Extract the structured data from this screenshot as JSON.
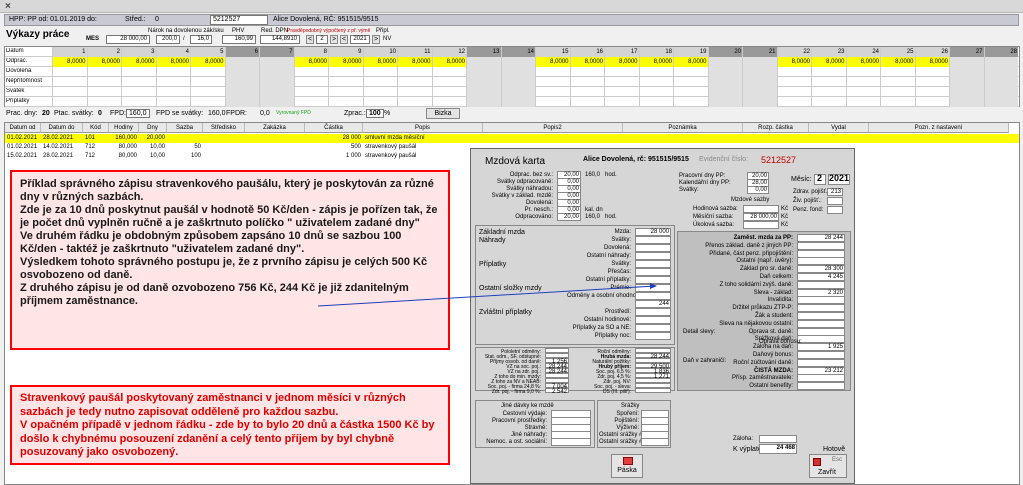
{
  "window": {
    "close_glyph": "×",
    "header_title": "HPP: PP od: 01.01.2019 do:",
    "header_stred_label": "Střed.:",
    "header_stred_value": "0",
    "header_code": "5212527",
    "header_employee": "Alice  Dovolená, RČ: 951515/9515"
  },
  "title": "Výkazy práce",
  "toolbar": {
    "narok_label": "Nárok na dovolenou zák/sku",
    "mes_label": "MES",
    "mes_value": "28 000,00",
    "v1": "200,0",
    "sep": "/",
    "v2": "16,0",
    "phv_label": "PHV",
    "phv_value": "160,99",
    "red_label": "Red. DPN",
    "red_value": "144,8910",
    "pravd_label": "Pravděpodobný výpočtený z př. výmě",
    "prip_label": "Připl.",
    "nav_prev": "<",
    "nav_month": "2",
    "nav_next": ">",
    "nav_prev2": "<",
    "nav_year": "2021",
    "nav_next2": ">",
    "nv_label": "NV"
  },
  "grid": {
    "row_labels": [
      "Datum",
      "Odprac.",
      "Dovolená",
      "Nepřítomnost",
      "Svátek",
      "Příplatky"
    ],
    "days": [
      "1",
      "2",
      "3",
      "4",
      "5",
      "6",
      "7",
      "8",
      "9",
      "10",
      "11",
      "12",
      "13",
      "14",
      "15",
      "16",
      "17",
      "18",
      "19",
      "20",
      "21",
      "22",
      "23",
      "24",
      "25",
      "26",
      "27",
      "28"
    ],
    "odprac_value": "8,0000"
  },
  "summary": {
    "prac_dny_label": "Prac. dny:",
    "prac_dny_value": "20",
    "ptac_svatky_label": "Ptac. svátky:",
    "ptac_svatky_value": "0",
    "fpd_label": "FPD:",
    "fpd_value": "160,0",
    "fpd_sv_label": "FPD se svátky:",
    "fpd_sv_value": "160,0",
    "fpdr_label": "FPDR:",
    "fpdr_value": "0,0",
    "vyrovnany_label": "Vyrovnaný FPD",
    "zprac_label": "Zprac.:",
    "zprac_value": "100",
    "zprac_unit": "%",
    "bizka_button": "Bizka"
  },
  "list": {
    "columns": [
      "Datum od",
      "Datum do",
      "Kód",
      "Hodiny",
      "Dny",
      "Sazba",
      "Středisko",
      "Zakázka",
      "Částka",
      "Popis",
      "Popis2",
      "Poznámka",
      "Rozp. částka",
      "Vydal",
      "Pozn. z nastavení"
    ],
    "rows": [
      {
        "od": "01.02.2021",
        "do": "28.02.2021",
        "kod": "101",
        "hod": "160,000",
        "dny": "20,000",
        "sazba": "",
        "stred": "",
        "zak": "",
        "castka": "28 000",
        "popis": "smluvní mzda měsíční"
      },
      {
        "od": "01.02.2021",
        "do": "14.02.2021",
        "kod": "712",
        "hod": "80,000",
        "dny": "10,00",
        "sazba": "50",
        "stred": "",
        "zak": "",
        "castka": "500",
        "popis": "stravenkový paušál"
      },
      {
        "od": "15.02.2021",
        "do": "28.02.2021",
        "kod": "712",
        "hod": "80,000",
        "dny": "10,00",
        "sazba": "100",
        "stred": "",
        "zak": "",
        "castka": "1 000",
        "popis": "stravenkový paušál"
      }
    ]
  },
  "callout1": {
    "text": "Příklad správného zápisu stravenkového paušálu, který je poskytován za různé dny v různých sazbách.\nZde je za 10 dnů poskytnut paušál v hodnotě 50 Kč/den - zápis je pořízen tak, že je počet dnů vyplněn ručně a je zaškrtnuto políčko \" uživatelem zadané dny\"\nVe druhém řádku je obdobným způsobem zapsáno 10 dnů se sazbou 100 Kč/den - taktéž je zaškrtnuto \"uživatelem zadané dny\".\nVýsledkem tohoto správného postupu je, že z prvního zápisu je celých 500 Kč osvobozeno od daně.\nZ druhého zápisu je od daně ozvobozeno 756 Kč, 244 Kč je již zdanitelným příjmem zaměstnance."
  },
  "callout2": {
    "text": "Stravenkový paušál poskytovaný zaměstnanci v jednom měsíci v různých sazbách je tedy nutno zapisovat odděleně pro každou sazbu.\nV opačném případě v jednom řádku - zde by to bylo 20 dnů a částka 1500 Kč by došlo k chybnému posouzení zdanění a celý tento příjem by byl chybně posuzovaný jako osvobozený."
  },
  "mzdova": {
    "title": "Mzdová karta",
    "employee": "Alice  Dovolená, rč: 951515/9515",
    "evid_label": "Evidenční číslo:",
    "evid_value": "5212527",
    "mesic_label": "Měsíc:",
    "mesic_value": "2",
    "rok_value": "2021",
    "zdrav_label": "Zdrav. pojišť.:",
    "zdrav_value": "213",
    "ziv_label": "Živ. pojišť.:",
    "penz_label": "Penz. fond:",
    "hours_left": [
      {
        "l": "Odprac. bez sv.:",
        "a": "20,00",
        "b": "160,0",
        "u": "hod."
      },
      {
        "l": "Svátky odpracované:",
        "a": "0,00",
        "b": "",
        "u": ""
      },
      {
        "l": "Svátky náhradou:",
        "a": "0,00",
        "b": "",
        "u": ""
      },
      {
        "l": "Svátky v základ. mzdě:",
        "a": "0,00",
        "b": "",
        "u": ""
      },
      {
        "l": "Dovolená:",
        "a": "0,00",
        "b": "",
        "u": ""
      },
      {
        "l": "Pr. nesch.:",
        "a": "0,00",
        "b": "kal. dn",
        "u": ""
      },
      {
        "l": "Odpracováno:",
        "a": "20,00",
        "b": "160,0",
        "u": "hod."
      }
    ],
    "pracdny_label": "Pracovní dny PP:",
    "pracdny_value": "20,00",
    "kaldny_label": "Kalendářní dny PP:",
    "kaldny_value": "28,00",
    "svatky_label": "Svátky:",
    "svatky_value": "0,00",
    "mzdove_sazby": "Mzdové sazby",
    "hod_sazba_label": "Hodinová sazba:",
    "mes_sazba_label": "Měsíční sazba:",
    "mes_sazba_value": "28 000,00",
    "ukol_label": "Úkolová sazba:",
    "kc": "Kč",
    "left_items": [
      {
        "l": "Základní mzda",
        "r": "Mzda:",
        "v": "28 000"
      },
      {
        "l": "Náhrady",
        "r": "Svátky:",
        "v": ""
      },
      {
        "l": "",
        "r": "Dovolená:",
        "v": ""
      },
      {
        "l": "",
        "r": "Ostatní náhrady:",
        "v": ""
      },
      {
        "l": "Příplatky",
        "r": "Svátky:",
        "v": ""
      },
      {
        "l": "",
        "r": "Přesčas:",
        "v": ""
      },
      {
        "l": "",
        "r": "Ostatní příplatky:",
        "v": ""
      },
      {
        "l": "Ostatní složky mzdy",
        "r": "Prémie:",
        "v": ""
      },
      {
        "l": "",
        "r": "Odměny a osobní ohodnocení:",
        "v": ""
      },
      {
        "l": "",
        "r": "",
        "v": "244"
      },
      {
        "l": "Zvláštní příplatky",
        "r": "Prostředí:",
        "v": ""
      },
      {
        "l": "",
        "r": "Ostatní hodinové:",
        "v": ""
      },
      {
        "l": "",
        "r": "Příplatky za SO a NE:",
        "v": ""
      },
      {
        "l": "",
        "r": "Příplatky noc:",
        "v": ""
      }
    ],
    "right_items": [
      {
        "l": "Zaměst. mzda za PP:",
        "v": "28 244"
      },
      {
        "l": "Přenos základ. daně z jiných PP:",
        "v": ""
      },
      {
        "l": "Přidané, část penz. připojištění:",
        "v": ""
      },
      {
        "l": "Ostatní (např. úvěry):",
        "v": ""
      },
      {
        "l": "Základ pro sr. daně:",
        "v": "28 300"
      },
      {
        "l": "Daň celkem:",
        "v": "4 245"
      },
      {
        "l": "Z toho solidární zvýš. daně:",
        "v": ""
      },
      {
        "l": "Sleva - základ:",
        "v": "2 320"
      },
      {
        "l": "Invalidita:",
        "v": ""
      },
      {
        "l": "Držitel průkazu ZTP-P:",
        "v": ""
      },
      {
        "l": "Žák a student:",
        "v": ""
      },
      {
        "l": "Sleva na nějakovou ostatní:",
        "v": ""
      },
      {
        "l": "Oprava st. daně:",
        "v": ""
      },
      {
        "l": "Srážková daň:",
        "v": ""
      },
      {
        "l": "Záloha na daň:",
        "v": "1 925"
      },
      {
        "l": "Daňový bonus:",
        "v": ""
      },
      {
        "l": "Roční zúčtování daně:",
        "v": ""
      },
      {
        "l": "ČISTÁ MZDA:",
        "v": "23 212"
      },
      {
        "l": "Přísp. zaměstnavatele:",
        "v": ""
      },
      {
        "l": "Ostatní benefity:",
        "v": ""
      }
    ],
    "detail_slevy": "Detail slevy:",
    "oprava_bonusu": "Oprava bonusu:",
    "dan_zahranici": "Daň v zahraničí:",
    "bottom_left": [
      {
        "l": "Pololetní odměny:",
        "v": ""
      },
      {
        "l": "Stat. odm., SF, odstupné:",
        "v": ""
      },
      {
        "l": "Příjmy osvob. od daně:",
        "v": "1 256"
      },
      {
        "l": "VZ na soc. poj.:",
        "v": "28 244"
      },
      {
        "l": "VZ na zdr. poj.:",
        "v": "28 244"
      },
      {
        "l": "Z toho do min. mzdy:",
        "v": ""
      },
      {
        "l": "Z toho za NV a NEAB:",
        "v": ""
      },
      {
        "l": "Soc. poj. - firma 24,8 %:",
        "v": "7 004"
      },
      {
        "l": "Zdr. poj. - firma 9,0 %:",
        "v": "2 542"
      }
    ],
    "bottom_mid": [
      {
        "l": "Roční odměny:",
        "v": ""
      },
      {
        "l": "Hrubá mzda:",
        "v": "28 244"
      },
      {
        "l": "Naturální požitky:",
        "v": ""
      },
      {
        "l": "Hrubý příjem:",
        "v": "29 500"
      },
      {
        "l": "Soc. poj. 6,5 %:",
        "v": "1 836"
      },
      {
        "l": "Zdr. poj. 4,5 %:",
        "v": "1 271"
      },
      {
        "l": "Zdr. poj. NV:",
        "v": ""
      },
      {
        "l": "Soc. poj. - sleva:",
        "v": ""
      },
      {
        "l": "DS (III. pilíř):",
        "v": ""
      }
    ],
    "jine_title": "Jiné dávky ke mzdě",
    "jine_items": [
      "Cestovní výdaje:",
      "Pracovní prostředky:",
      "Stravné:",
      "Jiné náhrady:",
      "Nemoc. a ost. sociální:"
    ],
    "srazky_title": "Srážky",
    "srazky_items": [
      "Spoření:",
      "Pojištění:",
      "Výživné:",
      "Ostatní srážky #1:",
      "Ostatní srážky #2:"
    ],
    "zaloha_label": "Záloha:",
    "kvyplate_label": "K výplatě:",
    "kvyplate_value": "24 468",
    "hotove": "Hotově",
    "paska_button": "Páska",
    "esc_label": "Esc",
    "zavrit_button": "Zavřít"
  },
  "colors": {
    "callout_border": "#ff0000",
    "callout_bg": "#ffe5e5",
    "highlight_yellow": "#ffff00",
    "arrow": "#1f3fbf"
  }
}
